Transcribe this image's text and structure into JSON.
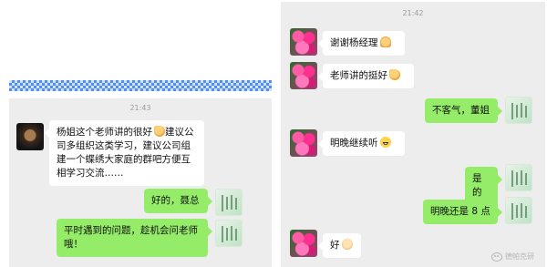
{
  "left_chat": {
    "timestamp": "21:43",
    "messages": [
      {
        "side": "in",
        "text": "杨姐这个老师讲的很好",
        "emoji": "thumbs-up",
        "text_after": "建议公司多组织这类学习，建议公司组建一个蝶绣大家庭的群吧方便互相学习交流……"
      },
      {
        "side": "out",
        "text": "好的，聂总"
      },
      {
        "side": "out",
        "text": "平时遇到的问题，趁机会问老师哦！"
      }
    ]
  },
  "right_chat": {
    "timestamp": "21:42",
    "messages": [
      {
        "side": "in",
        "text": "谢谢杨经理",
        "emoji": "folded-hands"
      },
      {
        "side": "in",
        "text": "老师讲的挺好",
        "emoji": "thumbs-up"
      },
      {
        "side": "out",
        "text": "不客气，董姐"
      },
      {
        "side": "in",
        "text": "明晚继续听",
        "emoji": "grinning-face"
      },
      {
        "side": "out",
        "text": "是的"
      },
      {
        "side": "out",
        "text": "明晚还是 8 点"
      },
      {
        "side": "in",
        "text": "好",
        "emoji": "ok-hand"
      }
    ]
  },
  "watermark": {
    "text": "德帕克研"
  },
  "colors": {
    "bubble_out": "#95ec69",
    "bubble_in": "#ffffff",
    "chat_bg": "#ededed",
    "stripe": "#3b82f6"
  }
}
